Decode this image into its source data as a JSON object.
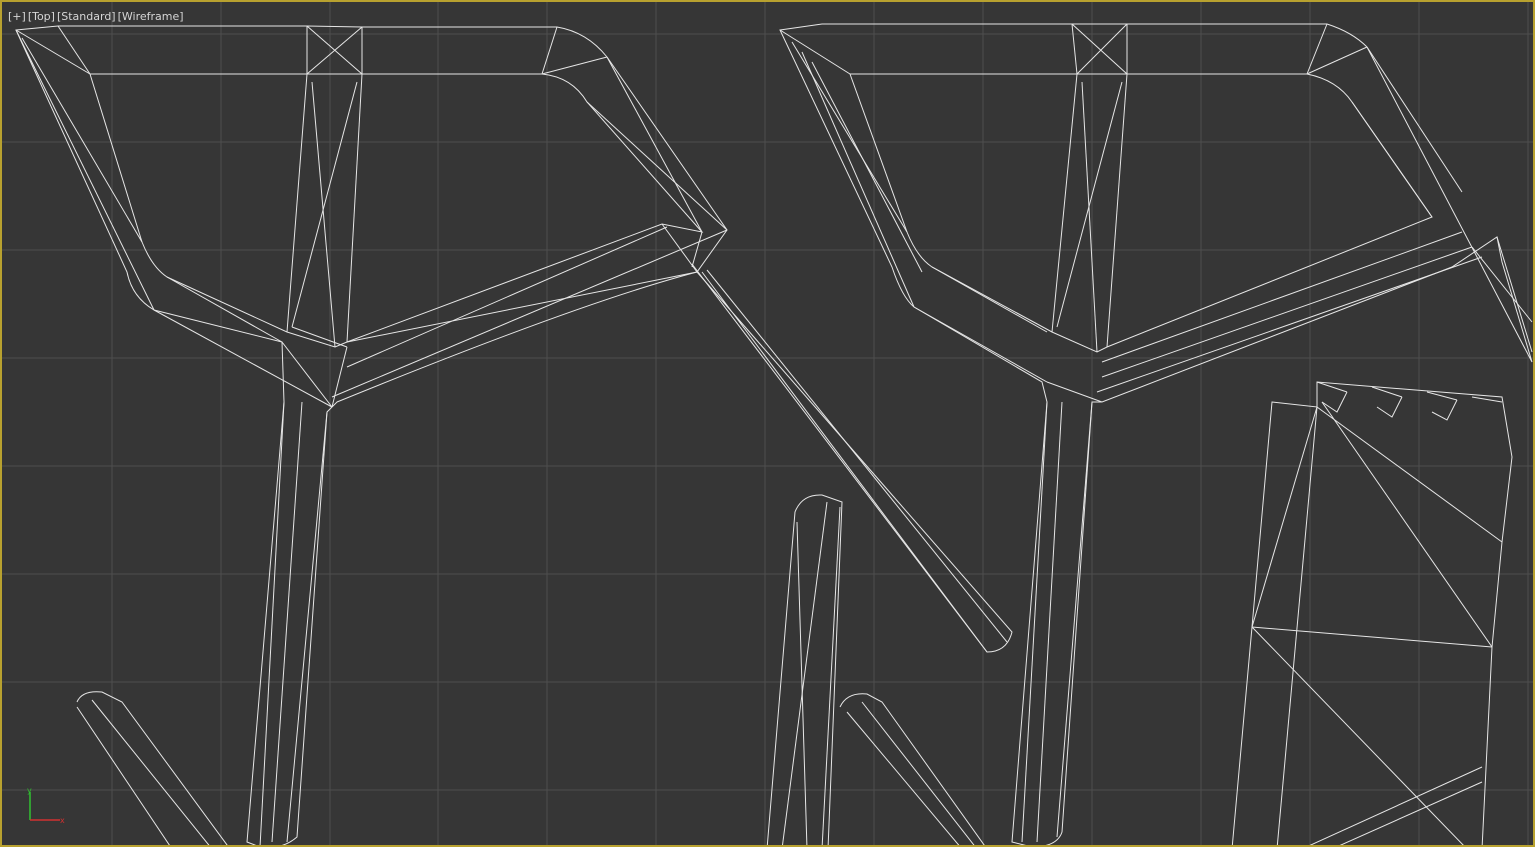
{
  "viewport": {
    "label_plus": "[+]",
    "label_view": "[Top]",
    "label_shading": "[Standard]",
    "label_mode": "[Wireframe]"
  },
  "gizmo": {
    "x_axis": "x",
    "y_axis": "y"
  },
  "colors": {
    "background": "#363636",
    "grid": "#4e4e4e",
    "wire": "#e6e6e6",
    "frame": "#b8a12f",
    "gizmo_x": "#d03030",
    "gizmo_y": "#30c030"
  }
}
